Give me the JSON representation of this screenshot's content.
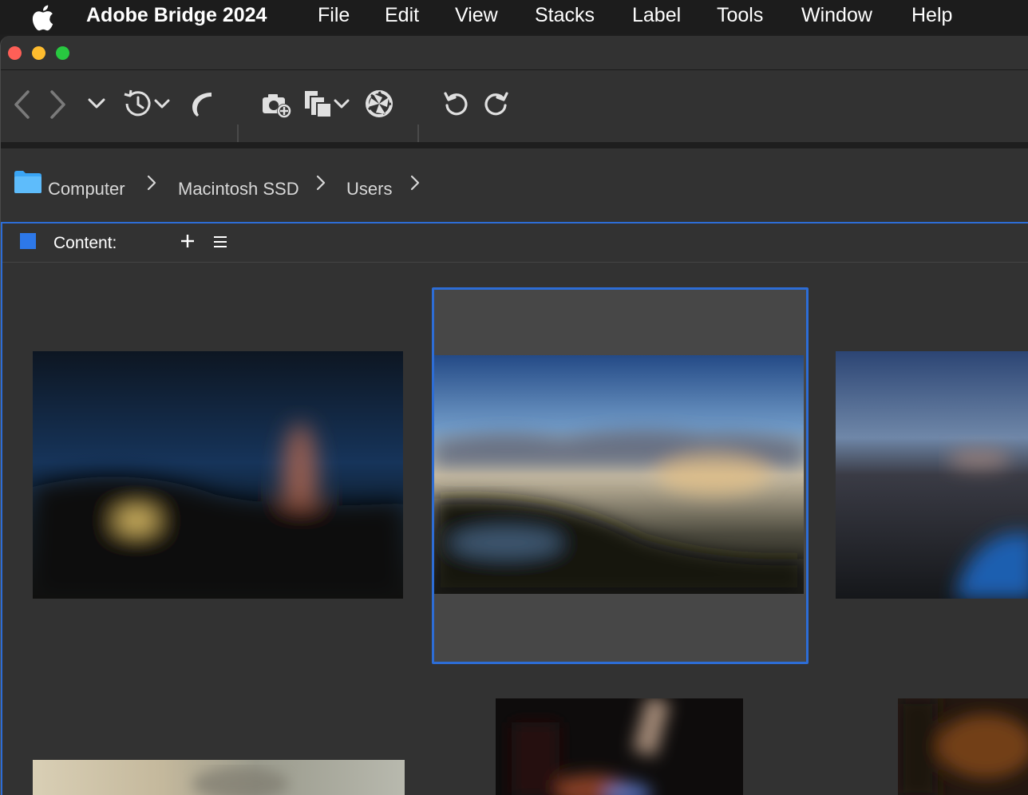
{
  "menubar": {
    "app_name": "Adobe Bridge 2024",
    "items": [
      "File",
      "Edit",
      "View",
      "Stacks",
      "Label",
      "Tools",
      "Window",
      "Help"
    ]
  },
  "window": {
    "traffic_lights": [
      "close",
      "minimize",
      "zoom"
    ]
  },
  "toolbar": {
    "buttons": [
      "back-icon",
      "forward-icon",
      "chevron-down-icon",
      "history-icon",
      "boomerang-icon",
      "camera-import-icon",
      "copy-icon",
      "aperture-icon",
      "rotate-ccw-icon",
      "rotate-cw-icon"
    ]
  },
  "breadcrumb": {
    "items": [
      "Computer",
      "Macintosh SSD",
      "Users"
    ]
  },
  "content_panel": {
    "title": "Content:"
  },
  "thumbnails": [
    {
      "name": "night-sky-photo",
      "selected": false
    },
    {
      "name": "mountain-sunrise-photo",
      "selected": true
    },
    {
      "name": "coastal-dusk-photo",
      "selected": false
    },
    {
      "name": "bright-snow-photo",
      "selected": false
    },
    {
      "name": "dark-interior-photo",
      "selected": false
    },
    {
      "name": "warm-interior-photo",
      "selected": false
    }
  ],
  "colors": {
    "accent": "#2d6dd6",
    "panel_bg": "#323232",
    "menubar_bg": "#1c1c1c"
  }
}
